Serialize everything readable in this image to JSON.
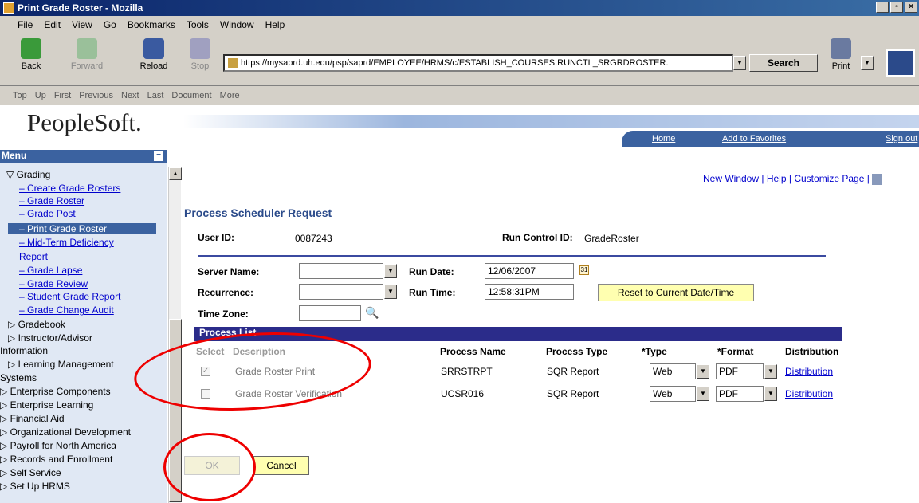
{
  "window": {
    "title": "Print Grade Roster - Mozilla"
  },
  "menubar": [
    "File",
    "Edit",
    "View",
    "Go",
    "Bookmarks",
    "Tools",
    "Window",
    "Help"
  ],
  "toolbar": {
    "back": "Back",
    "forward": "Forward",
    "reload": "Reload",
    "stop": "Stop",
    "url": "https://mysaprd.uh.edu/psp/saprd/EMPLOYEE/HRMS/c/ESTABLISH_COURSES.RUNCTL_SRGRDROSTER.",
    "search": "Search",
    "print": "Print"
  },
  "personal_toolbar": [
    "Top",
    "Up",
    "First",
    "Previous",
    "Next",
    "Last",
    "Document",
    "More"
  ],
  "ps": {
    "logo": "PeopleSoft.",
    "home": "Home",
    "favorites": "Add to Favorites",
    "signout": "Sign out"
  },
  "sidebar": {
    "title": "Menu",
    "items": [
      {
        "label": "▽ Grading",
        "kind": "plain"
      },
      {
        "label": "– Create Grade Rosters",
        "kind": "link"
      },
      {
        "label": "– Grade Roster",
        "kind": "link"
      },
      {
        "label": "– Grade Post",
        "kind": "link"
      },
      {
        "label": "– Print Grade Roster",
        "kind": "sel"
      },
      {
        "label": "– Mid-Term Deficiency",
        "kind": "link"
      },
      {
        "label": "Report",
        "kind": "link"
      },
      {
        "label": "– Grade Lapse",
        "kind": "link"
      },
      {
        "label": "– Grade Review",
        "kind": "link"
      },
      {
        "label": "– Student Grade Report",
        "kind": "link"
      },
      {
        "label": "– Grade Change Audit",
        "kind": "link"
      },
      {
        "label": "▷ Gradebook",
        "kind": "plain"
      },
      {
        "label": "▷ Instructor/Advisor",
        "kind": "plain"
      },
      {
        "label": "Information",
        "kind": "plain"
      },
      {
        "label": "▷ Learning Management",
        "kind": "plain"
      },
      {
        "label": "Systems",
        "kind": "plain"
      },
      {
        "label": "▷ Enterprise Components",
        "kind": "plain"
      },
      {
        "label": "▷ Enterprise Learning",
        "kind": "plain"
      },
      {
        "label": "▷ Financial Aid",
        "kind": "plain"
      },
      {
        "label": "▷ Organizational Development",
        "kind": "plain"
      },
      {
        "label": "▷ Payroll for North America",
        "kind": "plain"
      },
      {
        "label": "▷ Records and Enrollment",
        "kind": "plain"
      },
      {
        "label": "▷ Self Service",
        "kind": "plain"
      },
      {
        "label": "▷ Set Up HRMS",
        "kind": "plain"
      }
    ]
  },
  "toplinks": {
    "new_window": "New Window",
    "help": "Help",
    "customize": "Customize Page",
    "sep": "|"
  },
  "page": {
    "title": "Process Scheduler Request",
    "user_id_label": "User ID:",
    "user_id": "0087243",
    "run_control_label": "Run Control ID:",
    "run_control": "GradeRoster",
    "server_label": "Server Name:",
    "server_value": "",
    "recurrence_label": "Recurrence:",
    "recurrence_value": "",
    "timezone_label": "Time Zone:",
    "timezone_value": "",
    "run_date_label": "Run Date:",
    "run_date": "12/06/2007",
    "run_time_label": "Run Time:",
    "run_time": "12:58:31PM",
    "reset_label": "Reset to Current Date/Time"
  },
  "process_list": {
    "title": "Process List",
    "headers": {
      "select": "Select",
      "description": "Description",
      "name": "Process Name",
      "type": "Process Type",
      "otype": "*Type",
      "format": "*Format",
      "distribution": "Distribution"
    },
    "rows": [
      {
        "checked": true,
        "description": "Grade Roster Print",
        "name": "SRRSTRPT",
        "type": "SQR Report",
        "otype": "Web",
        "format": "PDF",
        "distribution": "Distribution"
      },
      {
        "checked": false,
        "description": "Grade Roster Verification",
        "name": "UCSR016",
        "type": "SQR Report",
        "otype": "Web",
        "format": "PDF",
        "distribution": "Distribution"
      }
    ]
  },
  "buttons": {
    "ok": "OK",
    "cancel": "Cancel"
  },
  "colors": {
    "annotation": "#e00000",
    "ps_blue": "#3b62a0",
    "process_header": "#2b2c8a"
  }
}
